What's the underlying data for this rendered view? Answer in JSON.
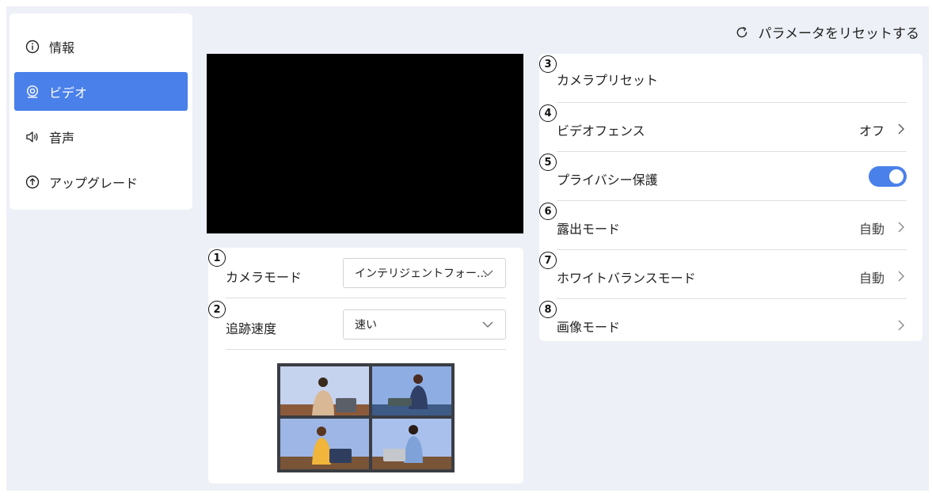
{
  "header": {
    "reset_label": "パラメータをリセットする"
  },
  "sidebar": {
    "items": [
      {
        "label": "情報",
        "icon": "info-icon",
        "active": false
      },
      {
        "label": "ビデオ",
        "icon": "video-camera-icon",
        "active": true
      },
      {
        "label": "音声",
        "icon": "speaker-icon",
        "active": false
      },
      {
        "label": "アップグレード",
        "icon": "upgrade-icon",
        "active": false
      }
    ]
  },
  "camera_controls": {
    "camera_mode": {
      "badge": "1",
      "label": "カメラモード",
      "value": "インテリジェントフォー..."
    },
    "tracking_speed": {
      "badge": "2",
      "label": "追跡速度",
      "value": "速い"
    }
  },
  "settings": {
    "camera_preset": {
      "badge": "3",
      "label": "カメラプリセット"
    },
    "video_fence": {
      "badge": "4",
      "label": "ビデオフェンス",
      "value": "オフ"
    },
    "privacy": {
      "badge": "5",
      "label": "プライバシー保護",
      "toggle_on": true
    },
    "exposure_mode": {
      "badge": "6",
      "label": "露出モード",
      "value": "自動"
    },
    "white_balance": {
      "badge": "7",
      "label": "ホワイトバランスモード",
      "value": "自動"
    },
    "image_mode": {
      "badge": "8",
      "label": "画像モード"
    }
  },
  "colors": {
    "accent": "#4a80ea",
    "background": "#edf0f6"
  }
}
